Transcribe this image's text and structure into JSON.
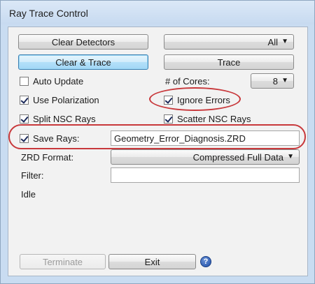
{
  "window": {
    "title": "Ray Trace Control"
  },
  "buttons": {
    "clear_detectors": "Clear Detectors",
    "clear_trace": "Clear & Trace",
    "trace": "Trace",
    "terminate": "Terminate",
    "exit": "Exit"
  },
  "detector_select": {
    "value": "All"
  },
  "cores": {
    "label": "# of Cores:",
    "value": "8"
  },
  "checkboxes": {
    "auto_update": {
      "label": "Auto Update",
      "checked": false
    },
    "use_polarization": {
      "label": "Use Polarization",
      "checked": true
    },
    "ignore_errors": {
      "label": "Ignore Errors",
      "checked": true
    },
    "split_nsc_rays": {
      "label": "Split NSC Rays",
      "checked": true
    },
    "scatter_nsc_rays": {
      "label": "Scatter NSC Rays",
      "checked": true
    },
    "save_rays": {
      "label": "Save Rays:",
      "checked": true
    }
  },
  "save_rays_file": {
    "value": "Geometry_Error_Diagnosis.ZRD"
  },
  "zrd_format": {
    "label": "ZRD Format:",
    "value": "Compressed Full Data"
  },
  "filter": {
    "label": "Filter:",
    "value": ""
  },
  "status": {
    "text": "Idle"
  },
  "help": {
    "glyph": "?"
  },
  "colors": {
    "highlight_ellipse": "#c8383b",
    "primary_button": "#a3d7f6"
  }
}
